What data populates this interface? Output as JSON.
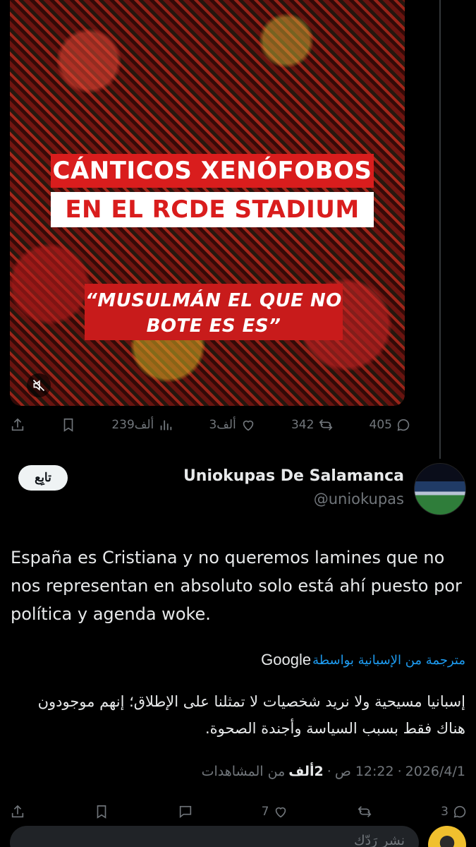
{
  "quoted_media": {
    "headline_line1": "CÁNTICOS XENÓFOBOS",
    "headline_line2": "EN EL RCDE STADIUM",
    "quote_text": "“MUSULMÁN EL QUE NO BOTE ES ES”",
    "mute_icon": "speaker-muted-icon"
  },
  "quoted_actions": {
    "replies": "405",
    "reposts": "342",
    "likes": "3ألف",
    "views": "239ألف"
  },
  "reply": {
    "display_name": "Uniokupas De Salamanca",
    "handle": "@uniokupas",
    "follow_label": "تابِع",
    "text": "España es Cristiana y no queremos lamines que no nos representan en absoluto solo está ahí puesto por política y agenda woke.",
    "translated_label": "مترجمة من الإسبانية بواسطة",
    "translator": "Google",
    "translation": "إسبانيا مسيحية ولا نريد شخصيات لا تمثلنا على الإطلاق؛ إنهم موجودون هناك فقط بسبب السياسة وأجندة الصحوة.",
    "date": "2026/4/1",
    "time": "12:22 ص",
    "views_count": "2ألف",
    "views_label": "من المشاهدات",
    "separator": "·"
  },
  "reply_actions": {
    "replies": "3",
    "likes": "7"
  },
  "composer": {
    "placeholder": "نشر رَدّك"
  },
  "colors": {
    "background": "#000000",
    "accent": "#1d9bf0",
    "muted": "#71767b",
    "text": "#e7e9ea"
  }
}
